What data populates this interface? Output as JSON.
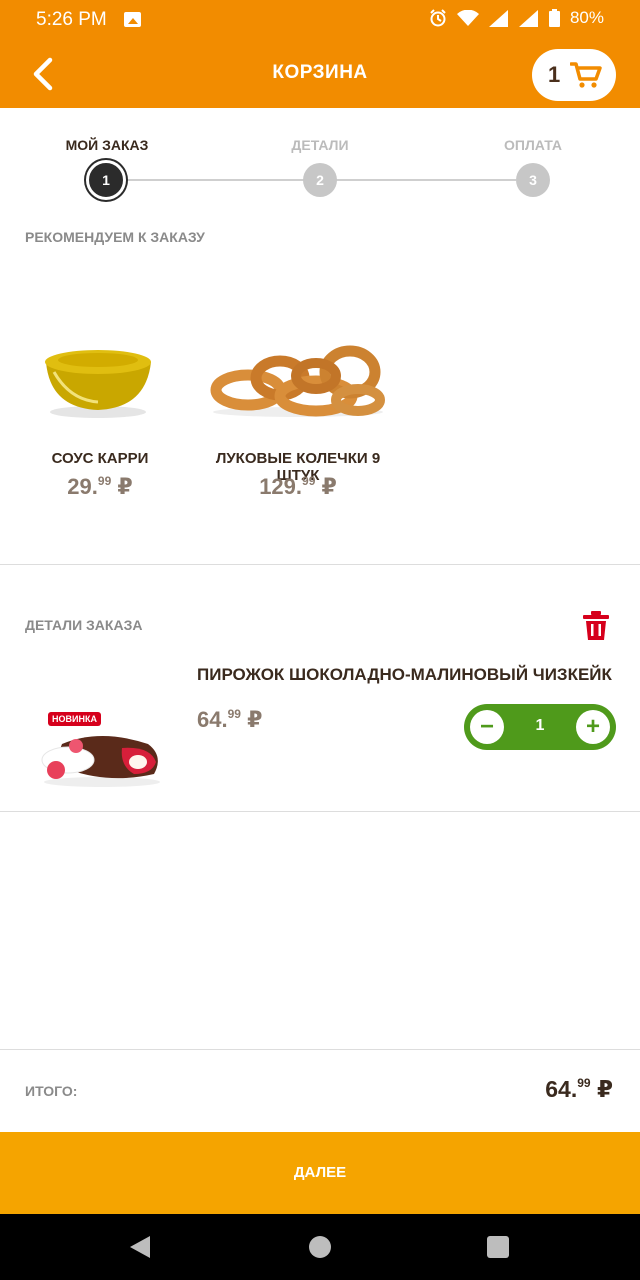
{
  "status_bar": {
    "time": "5:26 PM",
    "battery": "80%",
    "icons": [
      "image-icon",
      "alarm-icon",
      "wifi-icon",
      "signal-icon",
      "battery-icon"
    ]
  },
  "app_bar": {
    "title": "КОРЗИНА",
    "cart_count": "1"
  },
  "stepper": {
    "steps": [
      {
        "label": "МОЙ ЗАКАЗ",
        "number": "1",
        "active": true
      },
      {
        "label": "ДЕТАЛИ",
        "number": "2",
        "active": false
      },
      {
        "label": "ОПЛАТА",
        "number": "3",
        "active": false
      }
    ]
  },
  "recommendations": {
    "title": "РЕКОМЕНДУЕМ К ЗАКАЗУ",
    "items": [
      {
        "name": "СОУС КАРРИ",
        "price_main": "29.",
        "price_cents": "99",
        "currency": "₽"
      },
      {
        "name": "ЛУКОВЫЕ КОЛЕЧКИ 9 ШТУК",
        "price_main": "129.",
        "price_cents": "99",
        "currency": "₽"
      }
    ]
  },
  "order": {
    "title": "ДЕТАЛИ ЗАКАЗА",
    "item": {
      "name": "ПИРОЖОК ШОКОЛАДНО-МАЛИНОВЫЙ ЧИЗКЕЙК",
      "badge": "НОВИНКА",
      "price_main": "64.",
      "price_cents": "99",
      "currency": "₽",
      "quantity": "1"
    }
  },
  "total": {
    "label": "ИТОГО:",
    "price_main": "64.",
    "price_cents": "99",
    "currency": "₽"
  },
  "next_button": "ДАЛЕЕ",
  "colors": {
    "brand_orange": "#f28c00",
    "button_orange": "#f5a400",
    "qty_green": "#4f9a1b",
    "trash_red": "#d6001c"
  }
}
